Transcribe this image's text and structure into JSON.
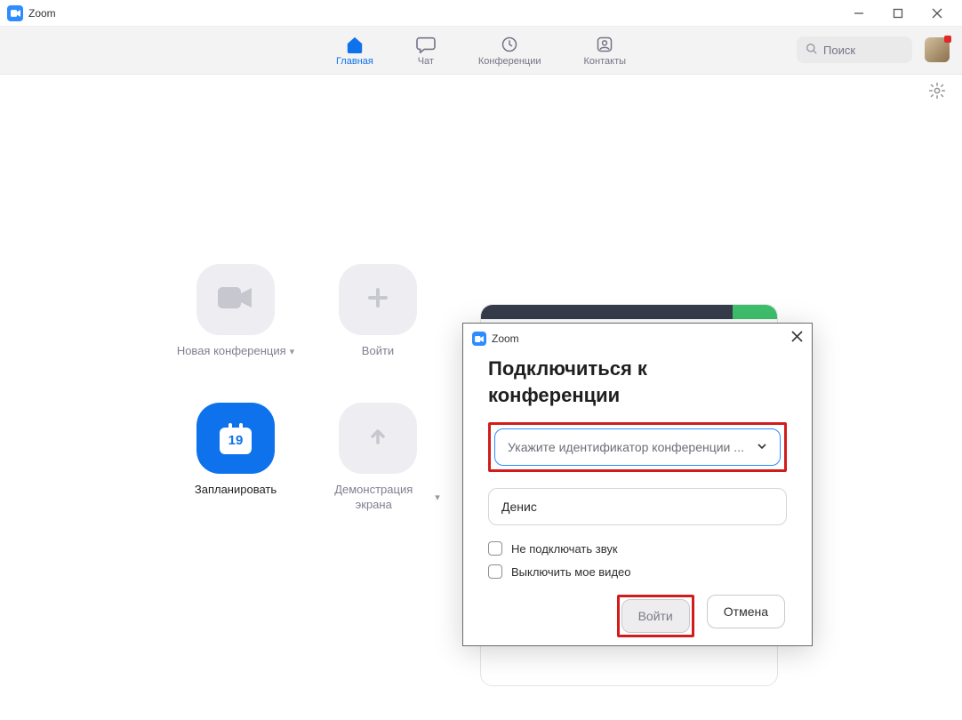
{
  "titlebar": {
    "app_name": "Zoom"
  },
  "nav": {
    "items": [
      {
        "label": "Главная"
      },
      {
        "label": "Чат"
      },
      {
        "label": "Конференции"
      },
      {
        "label": "Контакты"
      }
    ],
    "search_placeholder": "Поиск"
  },
  "tiles": {
    "new_meeting": "Новая конференция",
    "join": "Войти",
    "schedule": "Запланировать",
    "share_screen": "Демонстрация экрана",
    "calendar_day": "19"
  },
  "modal": {
    "app_name": "Zoom",
    "heading_line1": "Подключиться к",
    "heading_line2": "конференции",
    "id_placeholder": "Укажите идентификатор конференции ...",
    "name_value": "Денис",
    "opt_mute": "Не подключать звук",
    "opt_video": "Выключить мое видео",
    "join_label": "Войти",
    "cancel_label": "Отмена"
  }
}
